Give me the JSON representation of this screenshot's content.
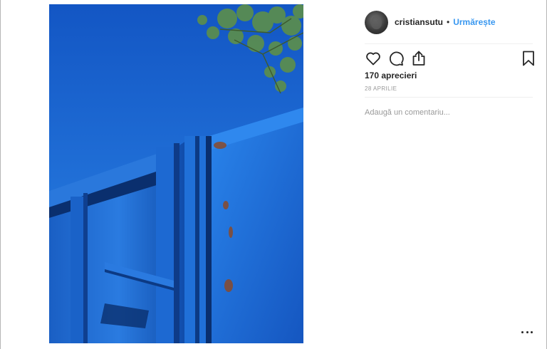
{
  "post": {
    "username": "cristiansutu",
    "separator": "•",
    "follow_label": "Urmărește",
    "likes_text": "170 aprecieri",
    "date_text": "28 APRILIE",
    "comment_placeholder": "Adaugă un comentariu..."
  },
  "icons": {
    "like": "heart-icon",
    "comment": "comment-icon",
    "share": "share-icon",
    "save": "bookmark-icon",
    "more": "more-options-icon"
  },
  "colors": {
    "accent": "#3897f0",
    "text": "#262626",
    "muted": "#999999"
  }
}
